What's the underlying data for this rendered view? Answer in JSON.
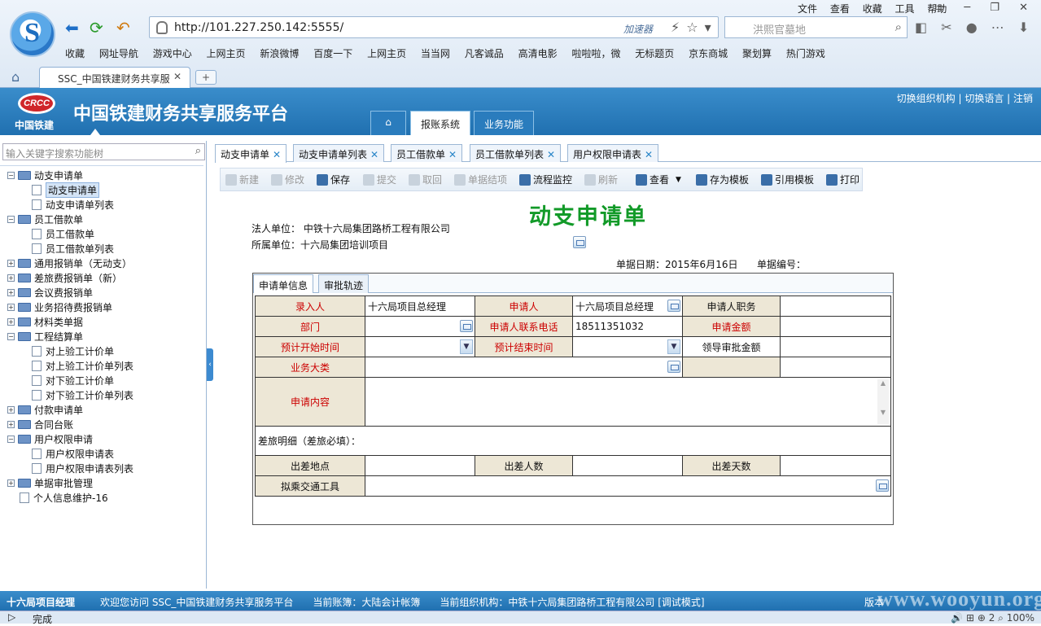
{
  "browser": {
    "url": "http://101.227.250.142:5555/",
    "accelerator": "加速器",
    "search_placeholder": "洪熙官墓地",
    "menu": [
      "文件",
      "查看",
      "收藏",
      "工具",
      "帮助"
    ],
    "bookmarks": [
      "收藏",
      "网址导航",
      "游戏中心",
      "上网主页",
      "新浪微博",
      "百度一下",
      "上网主页",
      "当当网",
      "凡客诚品",
      "高清电影",
      "啦啦啦，微",
      "无标题页",
      "京东商城",
      "聚划算",
      "热门游戏"
    ],
    "tab_title": "SSC_中国铁建财务共享服",
    "status_done": "完成",
    "zoom": "100%",
    "count": "2"
  },
  "app": {
    "logo_text": "CRCC",
    "logo_name": "中国铁建",
    "title": "中国铁建财务共享服务平台",
    "top_links": "切换组织机构 | 切换语言 | 注销",
    "main_tabs": [
      "报账系统",
      "业务功能"
    ]
  },
  "sidebar": {
    "search_placeholder": "输入关键字搜索功能树",
    "tree": [
      {
        "label": "动支申请单",
        "level": 0,
        "type": "folder",
        "expanded": true
      },
      {
        "label": "动支申请单",
        "level": 1,
        "type": "doc",
        "selected": true
      },
      {
        "label": "动支申请单列表",
        "level": 1,
        "type": "doc"
      },
      {
        "label": "员工借款单",
        "level": 0,
        "type": "folder",
        "expanded": true
      },
      {
        "label": "员工借款单",
        "level": 1,
        "type": "doc"
      },
      {
        "label": "员工借款单列表",
        "level": 1,
        "type": "doc"
      },
      {
        "label": "通用报销单（无动支）",
        "level": 0,
        "type": "folder"
      },
      {
        "label": "差旅费报销单（新）",
        "level": 0,
        "type": "folder"
      },
      {
        "label": "会议费报销单",
        "level": 0,
        "type": "folder"
      },
      {
        "label": "业务招待费报销单",
        "level": 0,
        "type": "folder"
      },
      {
        "label": "材料类单据",
        "level": 0,
        "type": "folder"
      },
      {
        "label": "工程结算单",
        "level": 0,
        "type": "folder",
        "expanded": true
      },
      {
        "label": "对上验工计价单",
        "level": 1,
        "type": "doc"
      },
      {
        "label": "对上验工计价单列表",
        "level": 1,
        "type": "doc"
      },
      {
        "label": "对下验工计价单",
        "level": 1,
        "type": "doc"
      },
      {
        "label": "对下验工计价单列表",
        "level": 1,
        "type": "doc"
      },
      {
        "label": "付款申请单",
        "level": 0,
        "type": "folder"
      },
      {
        "label": "合同台账",
        "level": 0,
        "type": "folder"
      },
      {
        "label": "用户权限申请",
        "level": 0,
        "type": "folder",
        "expanded": true
      },
      {
        "label": "用户权限申请表",
        "level": 1,
        "type": "doc"
      },
      {
        "label": "用户权限申请表列表",
        "level": 1,
        "type": "doc"
      },
      {
        "label": "单据审批管理",
        "level": 0,
        "type": "folder"
      },
      {
        "label": "个人信息维护-16",
        "level": 0,
        "type": "doc"
      }
    ]
  },
  "content_tabs": [
    "动支申请单",
    "动支申请单列表",
    "员工借款单",
    "员工借款单列表",
    "用户权限申请表"
  ],
  "toolbar": [
    {
      "label": "新建",
      "enabled": false
    },
    {
      "label": "修改",
      "enabled": false
    },
    {
      "label": "保存",
      "enabled": true
    },
    {
      "label": "提交",
      "enabled": false
    },
    {
      "label": "取回",
      "enabled": false
    },
    {
      "label": "单据结项",
      "enabled": false
    },
    {
      "label": "流程监控",
      "enabled": true
    },
    {
      "label": "刷新",
      "enabled": false
    },
    {
      "label": "查看",
      "enabled": true
    },
    {
      "label": "存为模板",
      "enabled": true
    },
    {
      "label": "引用模板",
      "enabled": true
    },
    {
      "label": "打印",
      "enabled": true
    }
  ],
  "form": {
    "title": "动支申请单",
    "legal_entity_label": "法人单位：",
    "legal_entity": "中铁十六局集团路桥工程有限公司",
    "unit_label": "所属单位：",
    "unit": "十六局集团培训项目",
    "date_label": "单据日期：",
    "date": "2015年6月16日",
    "doc_no_label": "单据编号：",
    "panel_tabs": [
      "申请单信息",
      "审批轨迹"
    ],
    "fields": {
      "entered_by_label": "录入人",
      "entered_by": "十六局项目总经理",
      "applicant_label": "申请人",
      "applicant": "十六局项目总经理",
      "applicant_title_label": "申请人职务",
      "dept_label": "部门",
      "phone_label": "申请人联系电话",
      "phone": "18511351032",
      "amount_label": "申请金额",
      "start_label": "预计开始时间",
      "end_label": "预计结束时间",
      "leader_amount_label": "领导审批金额",
      "biz_label": "业务大类",
      "content_label": "申请内容",
      "travel_label": "差旅明细（差旅必填）：",
      "place_label": "出差地点",
      "people_label": "出差人数",
      "days_label": "出差天数",
      "vehicle_label": "拟乘交通工具"
    }
  },
  "status": {
    "user": "十六局项目经理",
    "message": "欢迎您访问 SSC_中国铁建财务共享服务平台　　当前账簿：大陆会计帐簿　　当前组织机构：中铁十六局集团路桥工程有限公司 [调试模式]",
    "version": "版本",
    "watermark": "www.wooyun.org"
  }
}
